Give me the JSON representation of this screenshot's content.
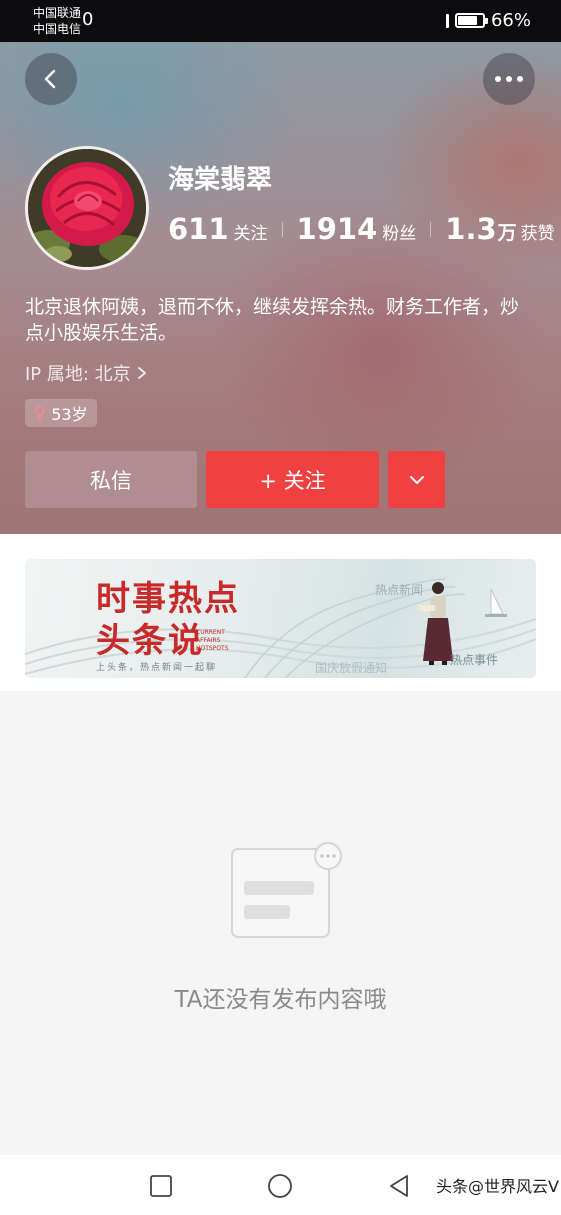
{
  "status_bar": {
    "carrier_1": "中国联通",
    "carrier_2": "中国电信",
    "time_partial": "0",
    "battery": "66%"
  },
  "profile": {
    "name": "海棠翡翠",
    "stats": [
      {
        "value": "611",
        "unit": "",
        "label": "关注"
      },
      {
        "value": "1914",
        "unit": "",
        "label": "粉丝"
      },
      {
        "value": "1.3",
        "unit": "万",
        "label": "获赞"
      }
    ],
    "bio": "北京退休阿姨，退而不休，继续发挥余热。财务工作者，炒点小股娱乐生活。",
    "ip_location": "IP 属地: 北京",
    "age_tag": "53岁",
    "gender_symbol": "♀"
  },
  "actions": {
    "message_label": "私信",
    "follow_label": "+ 关注"
  },
  "banner": {
    "title_line1": "时事热点",
    "title_line2": "头条说",
    "english_lines": [
      "CURRENT",
      "AFFAIRS",
      "HOTSPOTS"
    ],
    "tagline": "上头条，热点新闻一起聊",
    "tag_top": "热点新闻",
    "tag_bottom": "热点事件",
    "faded_text": "国庆放假通知"
  },
  "empty_state": {
    "message": "TA还没有发布内容哦"
  },
  "watermark": "头条@世界风云V",
  "colors": {
    "accent_red": "#ef4142",
    "banner_red": "#c82a2a",
    "empty_text": "#8a8a8a"
  }
}
